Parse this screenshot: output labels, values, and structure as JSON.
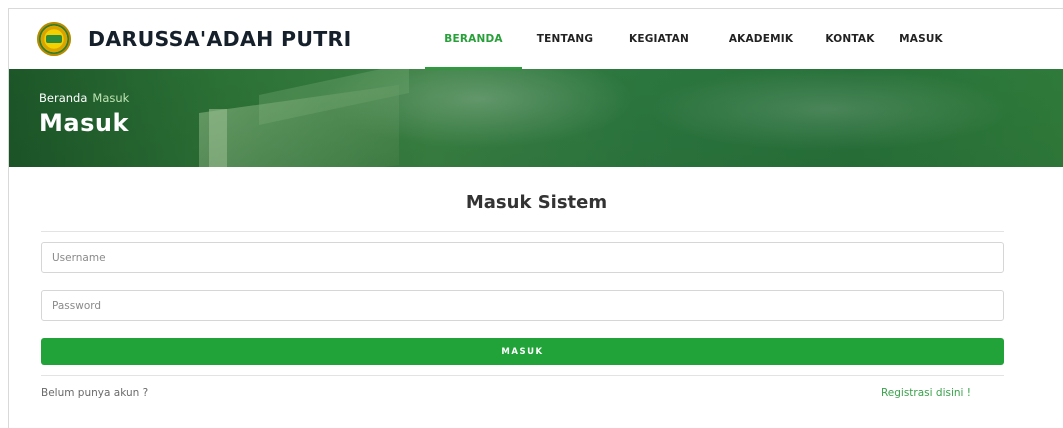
{
  "brand": {
    "name": "DARUSSA'ADAH PUTRI",
    "logo": "school-emblem-logo"
  },
  "nav": {
    "items": [
      {
        "label": "BERANDA",
        "active": true
      },
      {
        "label": "TENTANG",
        "active": false
      },
      {
        "label": "KEGIATAN",
        "active": false
      },
      {
        "label": "AKADEMIK",
        "active": false
      },
      {
        "label": "KONTAK",
        "active": false
      },
      {
        "label": "MASUK",
        "active": false
      }
    ],
    "active_color": "#28a03a"
  },
  "hero": {
    "breadcrumb": {
      "home": "Beranda",
      "current": "Masuk"
    },
    "title": "Masuk"
  },
  "login": {
    "title": "Masuk Sistem",
    "username": {
      "placeholder": "Username",
      "value": ""
    },
    "password": {
      "placeholder": "Password",
      "value": ""
    },
    "submit_label": "MASUK",
    "no_account_text": "Belum punya akun ?",
    "register_link": "Registrasi disini !",
    "button_color": "#21a33a"
  }
}
